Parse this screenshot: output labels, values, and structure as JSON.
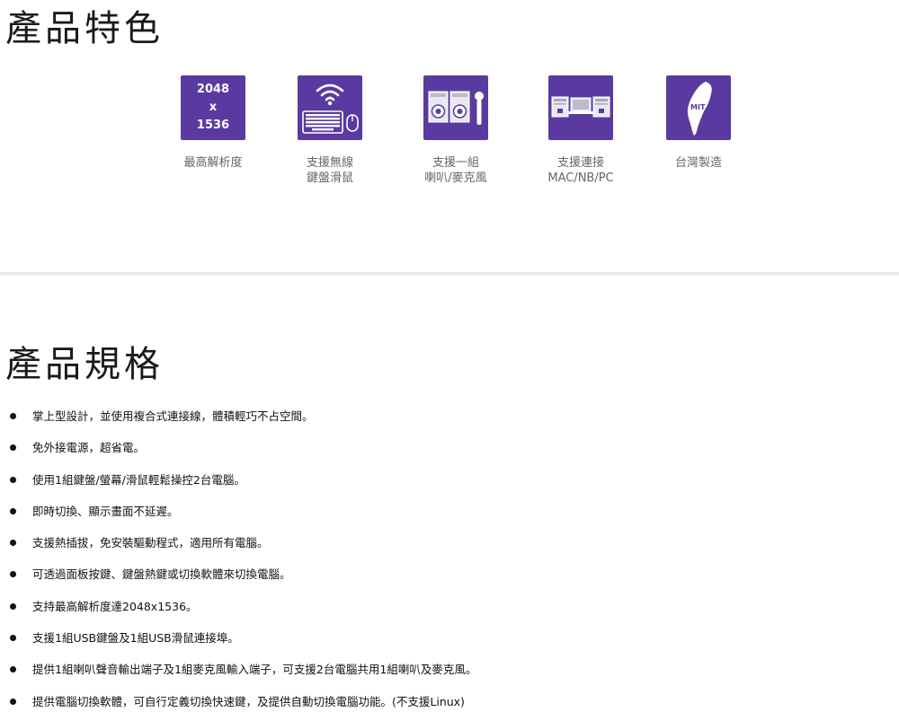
{
  "features_section": {
    "title": "產品特色",
    "items": [
      {
        "id": "resolution",
        "icon": "resolution-icon",
        "icon_lines": [
          "2048",
          "x",
          "1536"
        ],
        "label_lines": [
          "最高解析度"
        ]
      },
      {
        "id": "wireless",
        "icon": "wireless-keyboard-mouse-icon",
        "label_lines": [
          "支援無線",
          "鍵盤滑鼠"
        ]
      },
      {
        "id": "audio",
        "icon": "speakers-microphone-icon",
        "label_lines": [
          "支援一組",
          "喇叭/麥克風"
        ]
      },
      {
        "id": "platforms",
        "icon": "computers-icon",
        "label_lines": [
          "支援連接",
          "MAC/NB/PC"
        ]
      },
      {
        "id": "mit",
        "icon": "taiwan-map-icon",
        "icon_text": "MIT",
        "label_lines": [
          "台灣製造"
        ]
      }
    ]
  },
  "specs_section": {
    "title": "產品規格",
    "items": [
      "掌上型設計，並使用複合式連接線，體積輕巧不占空間。",
      "免外接電源，超省電。",
      "使用1組鍵盤/螢幕/滑鼠輕鬆操控2台電腦。",
      "即時切換、顯示畫面不延遲。",
      "支援熱插拔，免安裝驅動程式，適用所有電腦。",
      "可透過面板按鍵、鍵盤熱鍵或切換軟體來切換電腦。",
      "支持最高解析度達2048x1536。",
      "支援1組USB鍵盤及1組USB滑鼠連接埠。",
      "提供1組喇叭聲音輸出端子及1組麥克風輸入端子，可支援2台電腦共用1組喇叭及麥克風。",
      "提供電腦切換軟體，可自行定義切換快速鍵，及提供自動切換電腦功能。(不支援Linux)"
    ]
  },
  "colors": {
    "tile": "#5a3aa0",
    "label": "#666666",
    "text": "#111111"
  }
}
